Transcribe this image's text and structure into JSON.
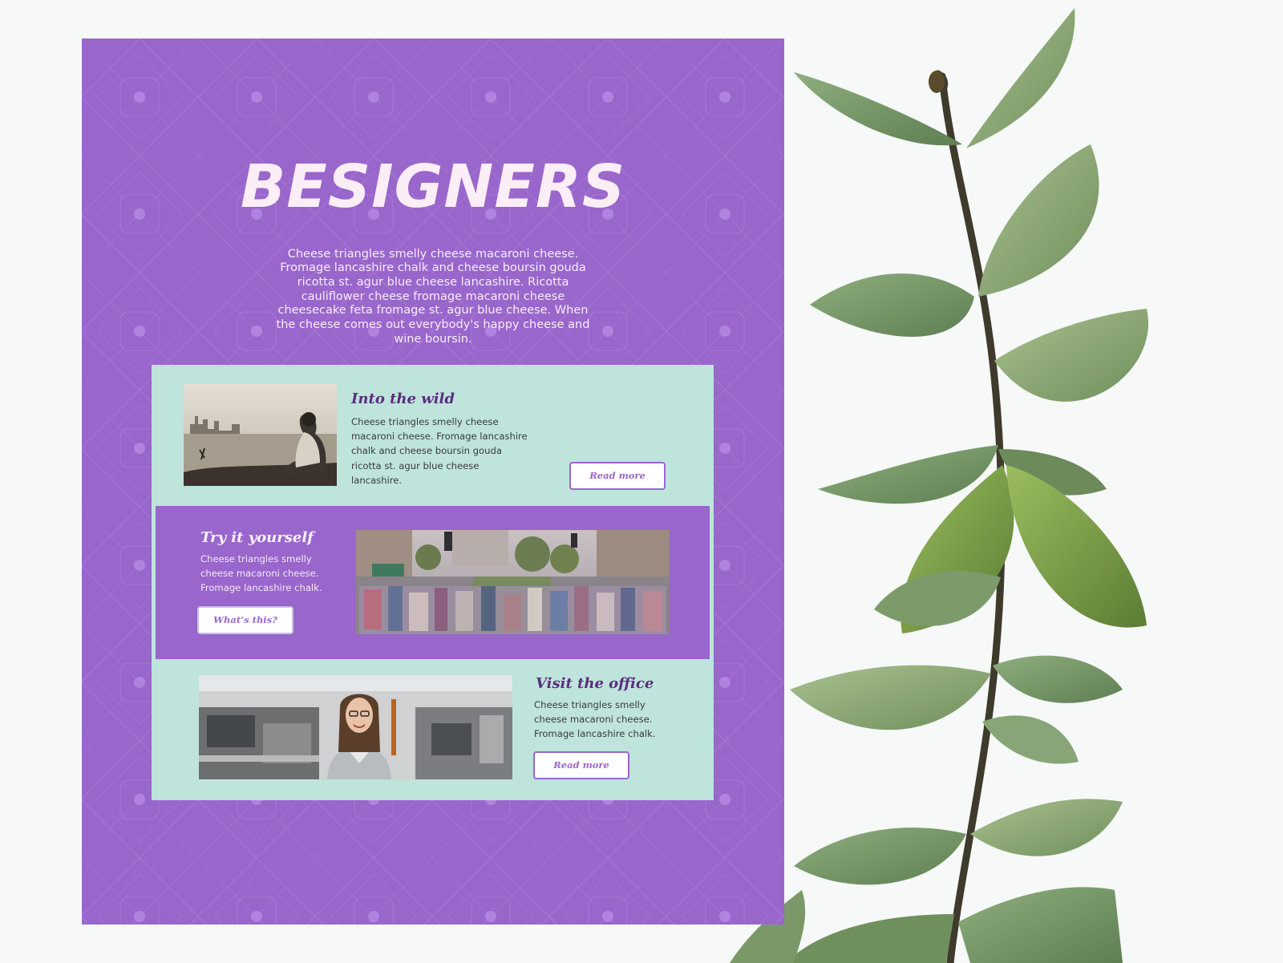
{
  "page": {
    "title": "BESIGNERS",
    "intro": "Cheese triangles smelly cheese macaroni cheese. Fromage lancashire chalk and cheese boursin gouda ricotta st. agur blue cheese lancashire. Ricotta cauliflower cheese fromage macaroni cheese cheesecake feta fromage st. agur blue cheese. When the cheese comes out everybody's happy cheese and wine boursin."
  },
  "sections": [
    {
      "heading": "Into the wild",
      "text": "Cheese triangles smelly cheese macaroni cheese. Fromage lancashire chalk and cheese boursin gouda ricotta st. agur blue cheese lancashire.",
      "button": "Read more",
      "image": "person-on-shore-city-skyline-photo"
    },
    {
      "heading": "Try it yourself",
      "text": "Cheese triangles smelly cheese macaroni cheese. Fromage lancashire chalk.",
      "button": "What’s this?",
      "image": "busy-street-crowd-photo"
    },
    {
      "heading": "Visit the office",
      "text": "Cheese triangles smelly cheese macaroni cheese. Fromage lancashire chalk.",
      "button": "Read more",
      "image": "woman-in-factory-photo"
    }
  ],
  "colors": {
    "poster": "#9966cc",
    "card": "#bee4dc",
    "title": "#fbeef6",
    "heading_dark": "#5a2e7d",
    "button_text": "#9966cc",
    "page_background": "#f7f8f8"
  },
  "decor": {
    "plant": "eucalyptus-branch-illustration"
  }
}
